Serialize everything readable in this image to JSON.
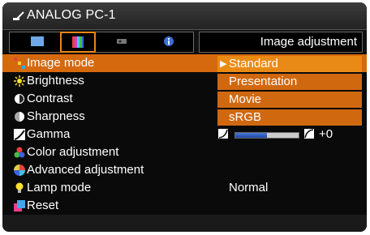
{
  "header": {
    "source": "ANALOG PC-1",
    "page_title": "Image adjustment"
  },
  "tabs": [
    {
      "icon": "screen-icon"
    },
    {
      "icon": "color-bars-icon",
      "selected": true
    },
    {
      "icon": "projector-icon"
    },
    {
      "icon": "info-icon"
    }
  ],
  "menu": {
    "items": [
      {
        "label": "Image mode",
        "icon": "image-mode-icon",
        "selected": true
      },
      {
        "label": "Brightness",
        "icon": "brightness-icon"
      },
      {
        "label": "Contrast",
        "icon": "contrast-icon"
      },
      {
        "label": "Sharpness",
        "icon": "sharpness-icon"
      },
      {
        "label": "Gamma",
        "icon": "gamma-icon"
      },
      {
        "label": "Color adjustment",
        "icon": "color-adjustment-icon"
      },
      {
        "label": "Advanced adjustment",
        "icon": "advanced-adjustment-icon"
      },
      {
        "label": "Lamp mode",
        "icon": "lamp-icon"
      },
      {
        "label": "Reset",
        "icon": "reset-icon"
      }
    ]
  },
  "image_mode_options": {
    "selected_marker": "▶",
    "items": [
      "Standard",
      "Presentation",
      "Movie",
      "sRGB"
    ],
    "active_index": 0
  },
  "gamma": {
    "value": "+0",
    "level": 0.5
  },
  "lamp_mode": {
    "value": "Normal"
  },
  "colors": {
    "accent": "#d5690e",
    "accent_active": "#ea8a16",
    "background": "#0a0a0a"
  }
}
